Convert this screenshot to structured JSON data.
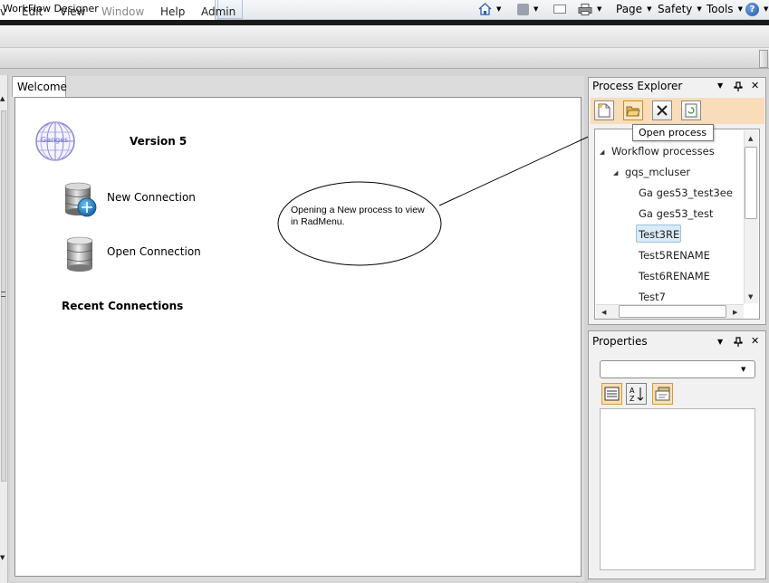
{
  "browser": {
    "tab_title": "WorkFlow Designer",
    "tools": [
      {
        "label": "Page",
        "icon": "page-menu"
      },
      {
        "label": "Safety",
        "icon": "safety-menu"
      },
      {
        "label": "Tools",
        "icon": "tools-menu"
      }
    ],
    "icons": [
      "home-icon",
      "rss-icon",
      "mail-icon",
      "print-icon",
      "help-icon"
    ],
    "help_glyph": "?"
  },
  "menu": {
    "items": [
      {
        "label": "v",
        "enabled": true
      },
      {
        "label": "Edit",
        "enabled": true
      },
      {
        "label": "View",
        "enabled": true
      },
      {
        "label": "Window",
        "enabled": false
      },
      {
        "label": "Help",
        "enabled": true
      },
      {
        "label": "Admin",
        "enabled": true
      }
    ]
  },
  "document": {
    "tab_label": "Welcome",
    "logo_text": "Ganges",
    "version_label": "Version 5",
    "new_connection_label": "New Connection",
    "open_connection_label": "Open Connection",
    "recent_connections_label": "Recent Connections"
  },
  "annotation": {
    "text": "Opening a New process to view in RadMenu."
  },
  "process_explorer": {
    "title": "Process Explorer",
    "tooltip": "Open process",
    "toolbar": [
      "new-process-icon",
      "open-folder-icon",
      "delete-icon",
      "refresh-icon"
    ],
    "tree": {
      "root": "Workflow processes",
      "user": "gqs_mcluser",
      "items": [
        {
          "label": "Ga   ges53_test3ee"
        },
        {
          "label": "Ga   ges53_test"
        },
        {
          "label": "Test3RE",
          "selected": true
        },
        {
          "label": "Test5RENAME"
        },
        {
          "label": "Test6RENAME"
        },
        {
          "label": "Test7"
        }
      ]
    }
  },
  "properties": {
    "title": "Properties",
    "combo_value": "",
    "buttons": [
      "categorized-icon",
      "sort-alpha-icon",
      "property-pages-icon"
    ]
  },
  "panel_controls": {
    "dropdown": "▼",
    "pin": "📌",
    "close": "✕"
  },
  "colors": {
    "toolbar_highlight": "#f9dcb8",
    "selection": "#d9ebf6",
    "logo_globe": "#8b86d6"
  }
}
